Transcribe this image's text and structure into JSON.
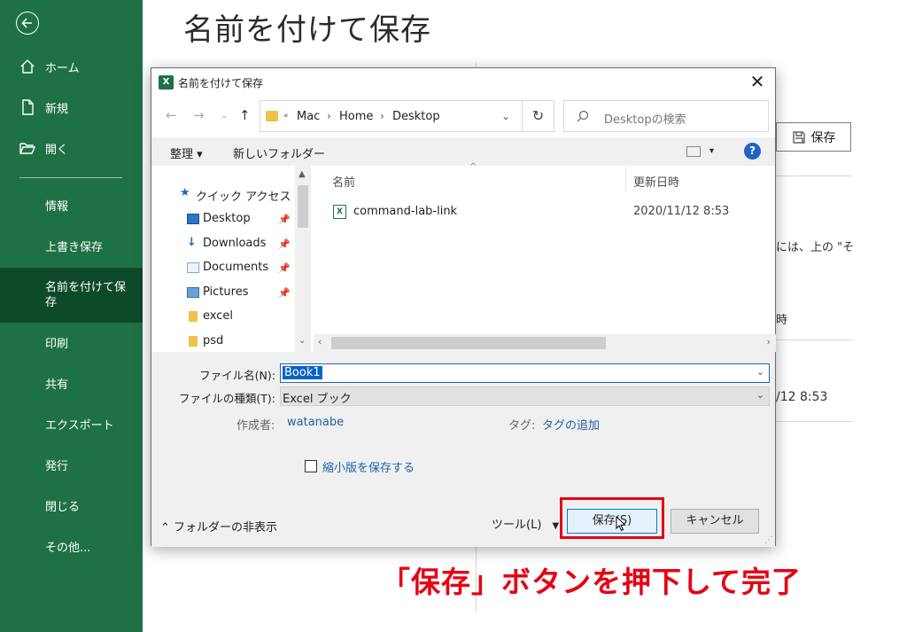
{
  "backstage": {
    "title": "名前を付けて保存",
    "nav": {
      "home": "ホーム",
      "new": "新規",
      "open": "開く",
      "info": "情報",
      "save": "上書き保存",
      "save_as": "名前を付けて保存",
      "print": "印刷",
      "share": "共有",
      "export": "エクスポート",
      "publish": "発行",
      "close": "閉じる",
      "more": "その他..."
    },
    "save_button": "保存",
    "peek_text_1": "には、上の \"そ",
    "peek_text_2": "時",
    "peek_text_3": "/12 8:53"
  },
  "dialog": {
    "title": "名前を付けて保存",
    "close_glyph": "✕",
    "path": [
      "Mac",
      "Home",
      "Desktop"
    ],
    "search_placeholder": "Desktopの検索",
    "organize": "整理 ▾",
    "new_folder": "新しいフォルダー",
    "tree": [
      {
        "label": "クイック アクセス",
        "icon": "star-icon"
      },
      {
        "label": "Desktop",
        "icon": "desktop-icon",
        "pinned": true
      },
      {
        "label": "Downloads",
        "icon": "download-icon",
        "pinned": true
      },
      {
        "label": "Documents",
        "icon": "document-icon",
        "pinned": true
      },
      {
        "label": "Pictures",
        "icon": "pictures-icon",
        "pinned": true
      },
      {
        "label": "excel",
        "icon": "folder-icon"
      },
      {
        "label": "psd",
        "icon": "folder-icon"
      }
    ],
    "columns": {
      "name": "名前",
      "modified": "更新日時"
    },
    "files": [
      {
        "name": "command-lab-link",
        "modified": "2020/11/12 8:53",
        "icon": "excel-file-icon"
      }
    ],
    "filename_label": "ファイル名(N):",
    "filename_value": "Book1",
    "filetype_label": "ファイルの種類(T):",
    "filetype_value": "Excel ブック",
    "author_label": "作成者:",
    "author_value": "watanabe",
    "tags_label": "タグ:",
    "tags_value": "タグの追加",
    "thumbnail_label": "縮小版を保存する",
    "hide_folders": "フォルダーの非表示",
    "tools": "ツール(L)",
    "save_button": "保存(S)",
    "cancel_button": "キャンセル"
  },
  "annotation": "「保存」ボタンを押下して完了",
  "colors": {
    "excel_green": "#1e7145",
    "nav_active": "#0e4a2a",
    "highlight_red": "#e60012",
    "selection_blue": "#0a64c8",
    "link_blue": "#1f5fa8"
  }
}
